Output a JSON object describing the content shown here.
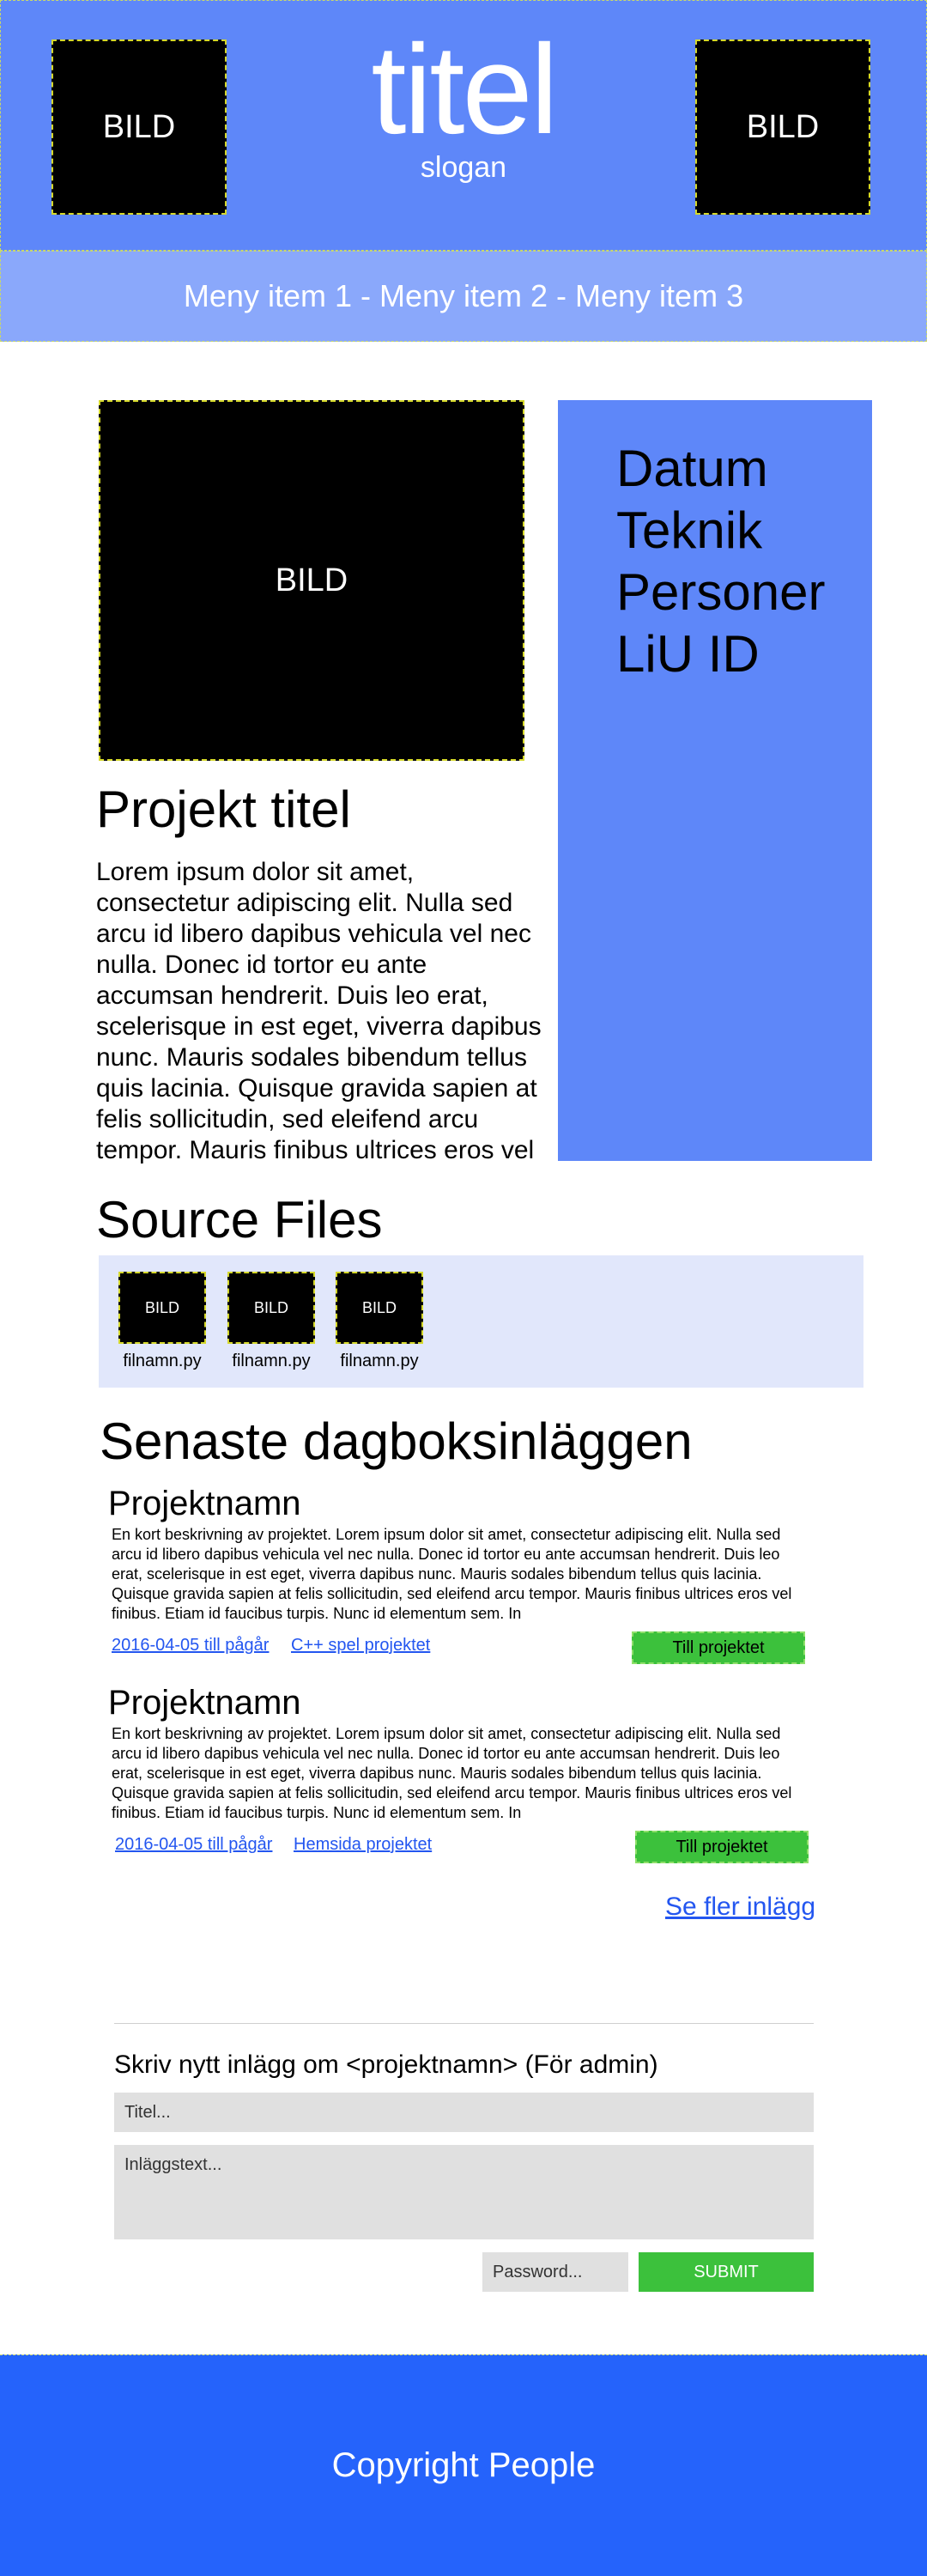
{
  "header": {
    "title": "titel",
    "slogan": "slogan",
    "image_left": "BILD",
    "image_right": "BILD"
  },
  "menu": {
    "text": "Meny item 1 - Meny item 2 - Meny item 3"
  },
  "project": {
    "image": "BILD",
    "title": "Projekt titel",
    "description": "Lorem ipsum dolor sit amet, consectetur adipiscing elit. Nulla sed arcu id libero dapibus vehicula vel nec nulla. Donec id tortor eu ante accumsan hendrerit. Duis leo erat, scelerisque in est eget, viverra dapibus nunc. Mauris sodales bibendum tellus quis lacinia. Quisque gravida sapien at felis sollicitudin, sed eleifend arcu tempor. Mauris finibus ultrices eros vel finibus. Etiam id",
    "info": [
      "Datum",
      "Teknik",
      "Personer",
      "LiU ID"
    ]
  },
  "source_files": {
    "title": "Source Files",
    "files": [
      {
        "image": "BILD",
        "name": "filnamn.py"
      },
      {
        "image": "BILD",
        "name": "filnamn.py"
      },
      {
        "image": "BILD",
        "name": "filnamn.py"
      }
    ]
  },
  "journal": {
    "title": "Senaste dagboksinläggen",
    "entries": [
      {
        "title": "Projektnamn",
        "description": "En kort beskrivning av projektet. Lorem ipsum dolor sit amet, consectetur adipiscing elit. Nulla sed arcu id libero dapibus vehicula vel nec nulla. Donec id tortor eu ante accumsan hendrerit. Duis leo erat, scelerisque in est eget, viverra dapibus nunc. Mauris sodales bibendum tellus quis lacinia. Quisque gravida sapien at felis sollicitudin, sed eleifend arcu tempor. Mauris finibus ultrices eros vel finibus. Etiam id faucibus turpis. Nunc id elementum sem. In",
        "date": "2016-04-05 till pågår",
        "tag": "C++ spel projektet",
        "button": "Till projektet"
      },
      {
        "title": "Projektnamn",
        "description": "En kort beskrivning av projektet. Lorem ipsum dolor sit amet, consectetur adipiscing elit. Nulla sed arcu id libero dapibus vehicula vel nec nulla. Donec id tortor eu ante accumsan hendrerit. Duis leo erat, scelerisque in est eget, viverra dapibus nunc. Mauris sodales bibendum tellus quis lacinia. Quisque gravida sapien at felis sollicitudin, sed eleifend arcu tempor. Mauris finibus ultrices eros vel finibus. Etiam id faucibus turpis. Nunc id elementum sem. In",
        "date": "2016-04-05 till pågår",
        "tag": "Hemsida projektet",
        "button": "Till projektet"
      }
    ],
    "see_more": "Se fler inlägg"
  },
  "admin_form": {
    "title": "Skriv nytt inlägg om <projektnamn> (För admin)",
    "title_placeholder": "Titel...",
    "text_placeholder": "Inläggstext...",
    "password_placeholder": "Password...",
    "submit": "SUBMIT"
  },
  "footer": {
    "text": "Copyright People"
  },
  "colors": {
    "header_bg": "#5e87f9",
    "menu_bg": "#8aa8fb",
    "sidebar_bg": "#5e87f9",
    "source_box_bg": "#e1e7fb",
    "button_green": "#3cc13c",
    "link_blue": "#2356f0",
    "footer_bg": "#2563fb"
  }
}
